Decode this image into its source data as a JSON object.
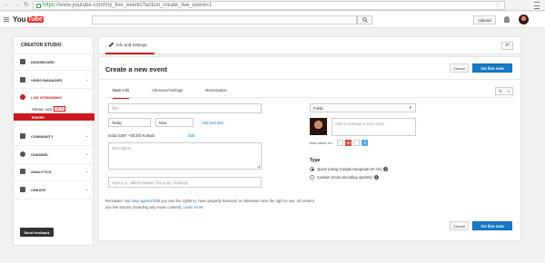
{
  "browser": {
    "url_scheme": "https://",
    "url_rest": "www.youtube.com/my_live_events?action_create_live_event=1"
  },
  "header": {
    "logo_you": "You",
    "logo_tube": "Tube",
    "upload_label": "Upload"
  },
  "sidebar": {
    "title": "CREATOR STUDIO",
    "items": {
      "dashboard": "DASHBOARD",
      "video_manager": "VIDEO MANAGER",
      "live_streaming": "LIVE STREAMING",
      "stream_now": "Stream now",
      "beta": "BETA",
      "events": "Events",
      "community": "COMMUNITY",
      "channel": "CHANNEL",
      "analytics": "ANALYTICS",
      "create": "CREATE"
    },
    "feedback_label": "Send feedback"
  },
  "top_tab": {
    "label": "Info and Settings"
  },
  "main": {
    "title": "Create a new event",
    "cancel_label": "Cancel",
    "golive_label": "Go live now",
    "tabs": {
      "basic": "Basic info",
      "advanced": "Advanced settings",
      "monetization": "Monetization"
    },
    "title_placeholder": "Title",
    "date_value": "Today",
    "time_value": "Now",
    "add_end_time": "Add end time",
    "timezone": "India (GMT +05:30) Kolkata",
    "timezone_edit": "Edit",
    "description_placeholder": "Description",
    "tags_placeholder": "Tags (e.g., albert einstein, flying pig, mashup)",
    "reminder": {
      "prefix": "Reminder: You ",
      "link1": "have agreed",
      "middle": " that you own the rights to, have properly licensed, or otherwise have the right to use, all content you live stream (including any music content). ",
      "link2": "Learn more."
    },
    "privacy_value": "Public",
    "message_placeholder": "Add a message to your video",
    "also_share_label": "Also share on",
    "gplus_label": "G+",
    "twitter_label": "t",
    "type_label": "Type",
    "type_quick": "Quick (using Google Hangouts On Air)",
    "type_custom": "Custom (more encoding options)"
  },
  "colors": {
    "accent_red": "#cc181e",
    "primary_blue": "#167ac6"
  }
}
